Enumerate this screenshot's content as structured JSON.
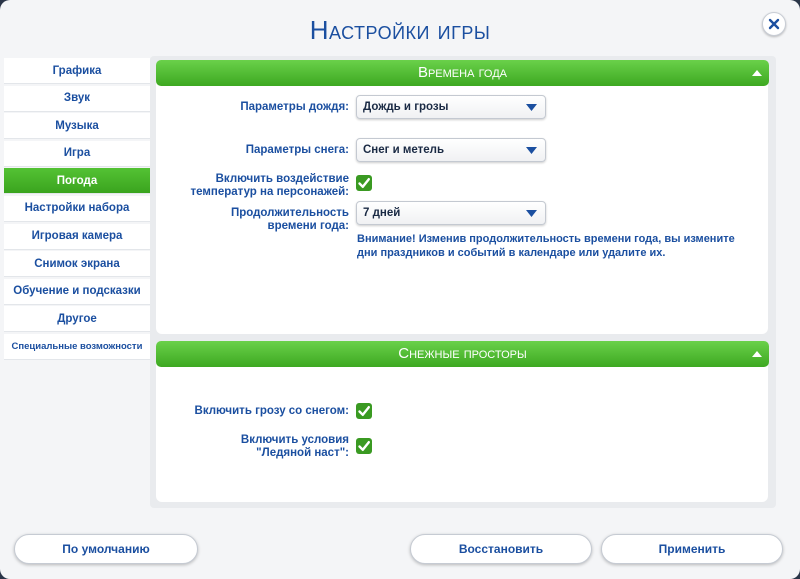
{
  "dialog": {
    "title": "Настройки игры"
  },
  "sidebar": {
    "items": [
      {
        "label": "Графика",
        "active": false
      },
      {
        "label": "Звук",
        "active": false
      },
      {
        "label": "Музыка",
        "active": false
      },
      {
        "label": "Игра",
        "active": false
      },
      {
        "label": "Погода",
        "active": true
      },
      {
        "label": "Настройки набора",
        "active": false
      },
      {
        "label": "Игровая камера",
        "active": false
      },
      {
        "label": "Снимок экрана",
        "active": false
      },
      {
        "label": "Обучение и подсказки",
        "active": false
      },
      {
        "label": "Другое",
        "active": false
      },
      {
        "label": "Специальные возможности",
        "active": false
      }
    ]
  },
  "seasons": {
    "header": "Времена года",
    "rain_label": "Параметры дождя:",
    "rain_value": "Дождь и грозы",
    "snow_label": "Параметры снега:",
    "snow_value": "Снег и метель",
    "temperature_label_line1": "Включить воздействие",
    "temperature_label_line2": "температур на персонажей:",
    "temperature_checked": true,
    "duration_label_line1": "Продолжительность",
    "duration_label_line2": "времени года:",
    "duration_value": "7 дней",
    "warning_line1": "Внимание! Изменив продолжительность времени года, вы измените",
    "warning_line2": "дни праздников и событий в календаре или удалите их."
  },
  "snowy": {
    "header": "Снежные просторы",
    "thundersnow_label": "Включить грозу со снегом:",
    "thundersnow_checked": true,
    "ice_label_line1": "Включить условия",
    "ice_label_line2": "\"Ледяной наст\":",
    "ice_checked": true
  },
  "footer": {
    "defaults_label": "По умолчанию",
    "restore_label": "Восстановить",
    "apply_label": "Применить"
  },
  "colors": {
    "accent_green": "#4cb62c",
    "text_blue": "#1b4fa0"
  }
}
